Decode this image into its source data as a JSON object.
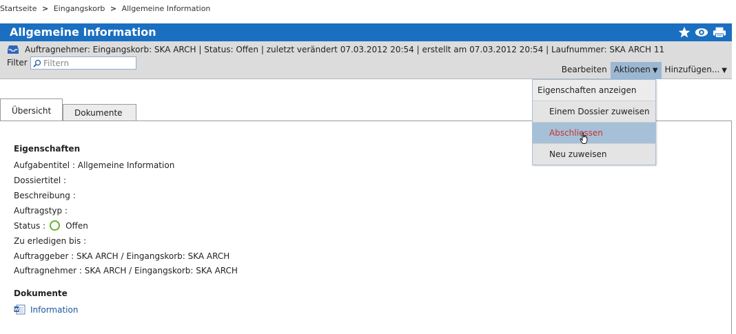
{
  "breadcrumb": {
    "items": [
      "Startseite",
      "Eingangskorb",
      "Allgemeine Information"
    ],
    "separator": ">"
  },
  "header": {
    "title": "Allgemeine Information",
    "icons": [
      "star-icon",
      "eye-icon",
      "print-icon"
    ]
  },
  "infobar": {
    "text": "Auftragnehmer: Eingangskorb: SKA ARCH | Status:  Offen | zuletzt verändert 07.03.2012 20:54 | erstellt am 07.03.2012 20:54 | Laufnummer: SKA ARCH 11"
  },
  "filter": {
    "label": "Filter",
    "placeholder": "Filtern"
  },
  "actions": {
    "edit": "Bearbeiten",
    "actions": "Aktionen",
    "add": "Hinzufügen..."
  },
  "dropdown": {
    "header": "Eigenschaften anzeigen",
    "items": [
      "Einem Dossier zuweisen",
      "Abschliessen",
      "Neu zuweisen"
    ]
  },
  "tabs": [
    "Übersicht",
    "Dokumente"
  ],
  "properties": {
    "title": "Eigenschaften",
    "task_title": "Aufgabentitel : Allgemeine Information",
    "dossier_title": "Dossiertitel :",
    "description": "Beschreibung :",
    "task_type": "Auftragstyp :",
    "status_label": "Status :",
    "status_value": "Offen",
    "due": "Zu erledigen bis :",
    "issuer": "Auftraggeber : SKA ARCH / Eingangskorb: SKA ARCH",
    "responsible": "Auftragnehmer : SKA ARCH / Eingangskorb: SKA ARCH"
  },
  "documents": {
    "title": "Dokumente",
    "items": [
      "Information"
    ]
  },
  "colors": {
    "header_blue": "#1a6fc0",
    "status_green": "#62b231",
    "hover_red": "#c8332a"
  }
}
